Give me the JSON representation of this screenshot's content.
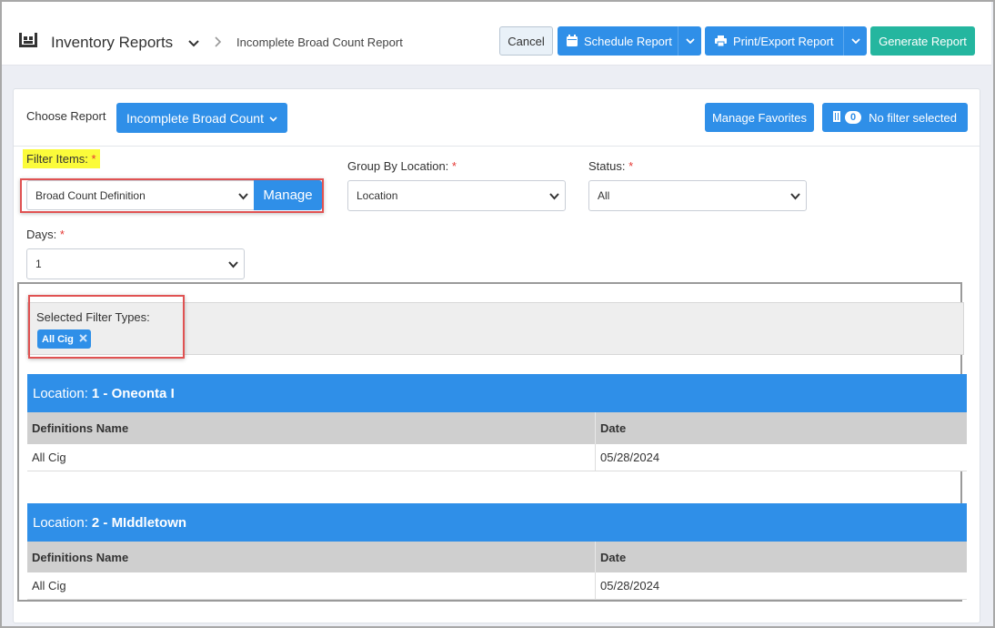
{
  "header": {
    "app_title": "Inventory Reports",
    "breadcrumb": "Incomplete Broad Count Report",
    "cancel_label": "Cancel",
    "schedule_label": "Schedule Report",
    "print_label": "Print/Export Report",
    "generate_label": "Generate Report"
  },
  "report": {
    "choose_label": "Choose Report",
    "selected_report": "Incomplete Broad Count",
    "manage_favorites_label": "Manage Favorites",
    "filter_count": "0",
    "filter_status": "No filter selected"
  },
  "filters": {
    "filter_items_label": "Filter Items:",
    "filter_items_value": "Broad Count Definition",
    "manage_label": "Manage",
    "group_by_label": "Group By Location:",
    "group_by_value": "Location",
    "status_label": "Status:",
    "status_value": "All",
    "days_label": "Days:",
    "days_value": "1",
    "required_mark": "*"
  },
  "selected_filter_types": {
    "label": "Selected Filter Types:",
    "chips": [
      "All Cig"
    ]
  },
  "locations": [
    {
      "prefix": "Location:",
      "name": "1 - Oneonta I",
      "columns": [
        "Definitions Name",
        "Date"
      ],
      "rows": [
        [
          "All Cig",
          "05/28/2024"
        ]
      ]
    },
    {
      "prefix": "Location:",
      "name": "2 - MIddletown",
      "columns": [
        "Definitions Name",
        "Date"
      ],
      "rows": [
        [
          "All Cig",
          "05/28/2024"
        ]
      ]
    }
  ],
  "colors": {
    "primary": "#2f8fe8",
    "success": "#24b69f",
    "highlight": "#fbfb3a",
    "annotation_red": "#e05252"
  }
}
